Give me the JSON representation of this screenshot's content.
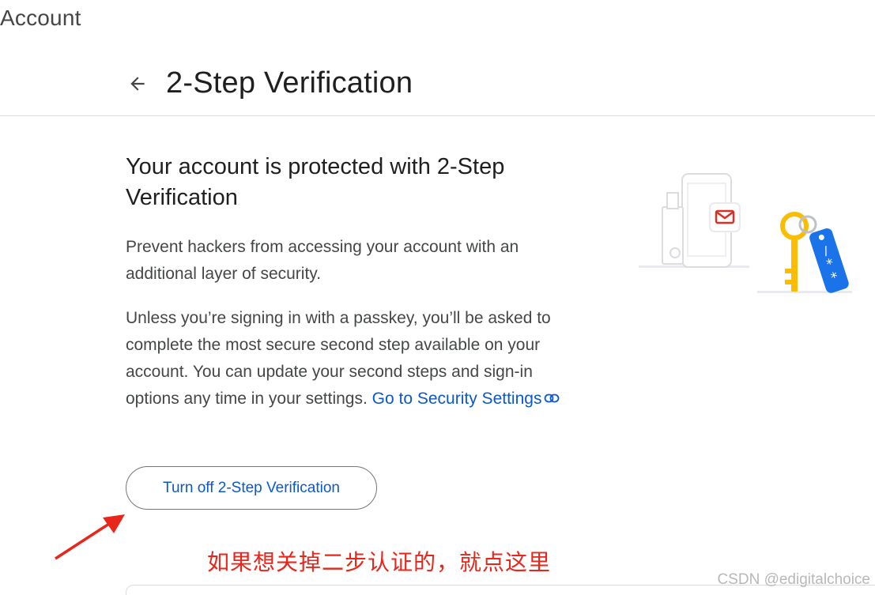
{
  "app": {
    "brand": "Account"
  },
  "header": {
    "title": "2-Step Verification"
  },
  "main": {
    "headline": "Your account is protected with 2-Step Verification",
    "paragraph1": "Prevent hackers from accessing your account with an additional layer of security.",
    "paragraph2_text": "Unless you’re signing in with a passkey, you’ll be asked to complete the most secure second step available on your account. You can update your second steps and sign-in options any time in your settings.",
    "security_link_label": "Go to Security Settings",
    "turn_off_button_label": "Turn off 2-Step Verification"
  },
  "annotation": {
    "text": "如果想关掉二步认证的，就点这里",
    "color": "#e8261b"
  },
  "watermark": {
    "text": "CSDN @edigitalchoice"
  },
  "icons": {
    "back": "arrow-back-icon",
    "link": "link-icon",
    "illustration": "phone-key-illustration"
  },
  "colors": {
    "link": "#0b57d0",
    "text_primary": "#1f1f1f",
    "text_secondary": "#444746",
    "key_yellow": "#fbbc04",
    "tag_blue": "#1a73e8",
    "mail_red": "#d93025"
  }
}
